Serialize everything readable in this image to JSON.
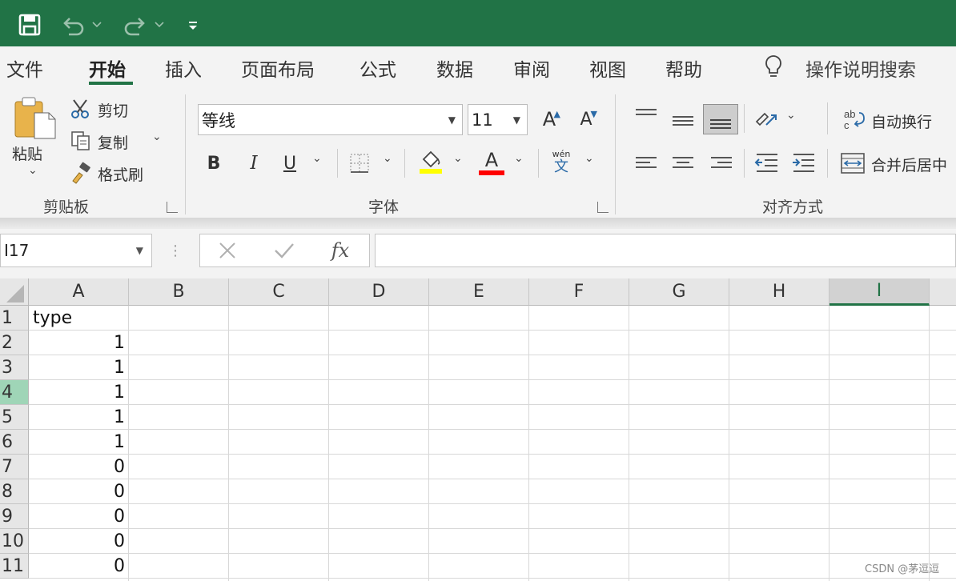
{
  "ribbon_tabs": [
    "文件",
    "开始",
    "插入",
    "页面布局",
    "公式",
    "数据",
    "审阅",
    "视图",
    "帮助"
  ],
  "tell_me": "操作说明搜索",
  "clipboard": {
    "paste": "粘贴",
    "cut": "剪切",
    "copy": "复制",
    "format_painter": "格式刷",
    "group_label": "剪贴板"
  },
  "font": {
    "name": "等线",
    "size": "11",
    "group_label": "字体",
    "bold": "B",
    "italic": "I",
    "underline": "U",
    "grow": "A",
    "shrink": "A",
    "font_color_letter": "A",
    "phonetic_top": "wén",
    "phonetic_bottom": "文"
  },
  "alignment": {
    "wrap_text": "自动换行",
    "merge_center": "合并后居中",
    "group_label": "对齐方式"
  },
  "formula_bar": {
    "name_box": "I17",
    "fx": "fx",
    "formula": ""
  },
  "grid": {
    "columns": [
      "A",
      "B",
      "C",
      "D",
      "E",
      "F",
      "G",
      "H",
      "I"
    ],
    "selected_column": "I",
    "rows": [
      {
        "num": "1",
        "a": "type"
      },
      {
        "num": "2",
        "a": "1"
      },
      {
        "num": "3",
        "a": "1"
      },
      {
        "num": "4",
        "a": "1"
      },
      {
        "num": "5",
        "a": "1"
      },
      {
        "num": "6",
        "a": "1"
      },
      {
        "num": "7",
        "a": "0"
      },
      {
        "num": "8",
        "a": "0"
      },
      {
        "num": "9",
        "a": "0"
      },
      {
        "num": "10",
        "a": "0"
      },
      {
        "num": "11",
        "a": "0"
      }
    ],
    "selected_row": "4"
  },
  "colors": {
    "title_bar": "#217346",
    "highlight_yellow": "#ffff00",
    "font_red": "#ff0000"
  },
  "watermark": "CSDN @茅逗逗"
}
